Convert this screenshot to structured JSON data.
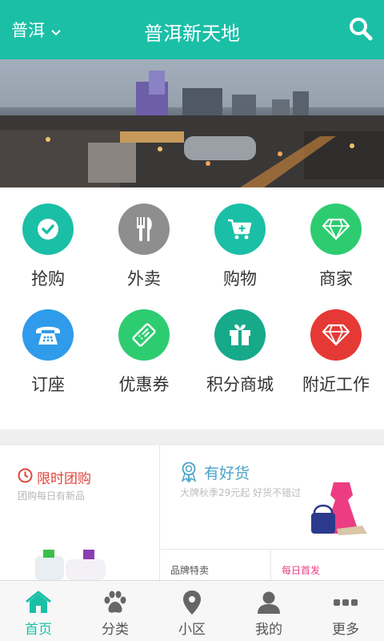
{
  "header": {
    "city": "普洱",
    "title": "普洱新天地",
    "background": "#1bbfa6"
  },
  "grid": {
    "items": [
      {
        "label": "抢购",
        "icon": "check-circle-icon",
        "color": "#1bbfa6"
      },
      {
        "label": "外卖",
        "icon": "fork-knife-icon",
        "color": "#8e8e8e"
      },
      {
        "label": "购物",
        "icon": "cart-plus-icon",
        "color": "#1bbfa6"
      },
      {
        "label": "商家",
        "icon": "diamond-icon",
        "color": "#2ecc71"
      },
      {
        "label": "订座",
        "icon": "telephone-icon",
        "color": "#2f9bea"
      },
      {
        "label": "优惠券",
        "icon": "ticket-icon",
        "color": "#2ecc71"
      },
      {
        "label": "积分商城",
        "icon": "gift-icon",
        "color": "#16a98a"
      },
      {
        "label": "附近工作",
        "icon": "diamond-red-icon",
        "color": "#e53935"
      }
    ]
  },
  "promo": {
    "group_buy_title": "限时团购",
    "group_buy_sub": "团购每日有新品",
    "goods_title": "有好货",
    "goods_sub": "大牌秋季29元起 好货不错过",
    "brand_sale": "品牌特卖",
    "daily_debut": "每日首发"
  },
  "tabbar": {
    "items": [
      {
        "label": "首页",
        "icon": "home-icon",
        "active": true
      },
      {
        "label": "分类",
        "icon": "paw-icon",
        "active": false
      },
      {
        "label": "小区",
        "icon": "location-pin-icon",
        "active": false
      },
      {
        "label": "我的",
        "icon": "user-icon",
        "active": false
      },
      {
        "label": "更多",
        "icon": "more-dots-icon",
        "active": false
      }
    ]
  }
}
